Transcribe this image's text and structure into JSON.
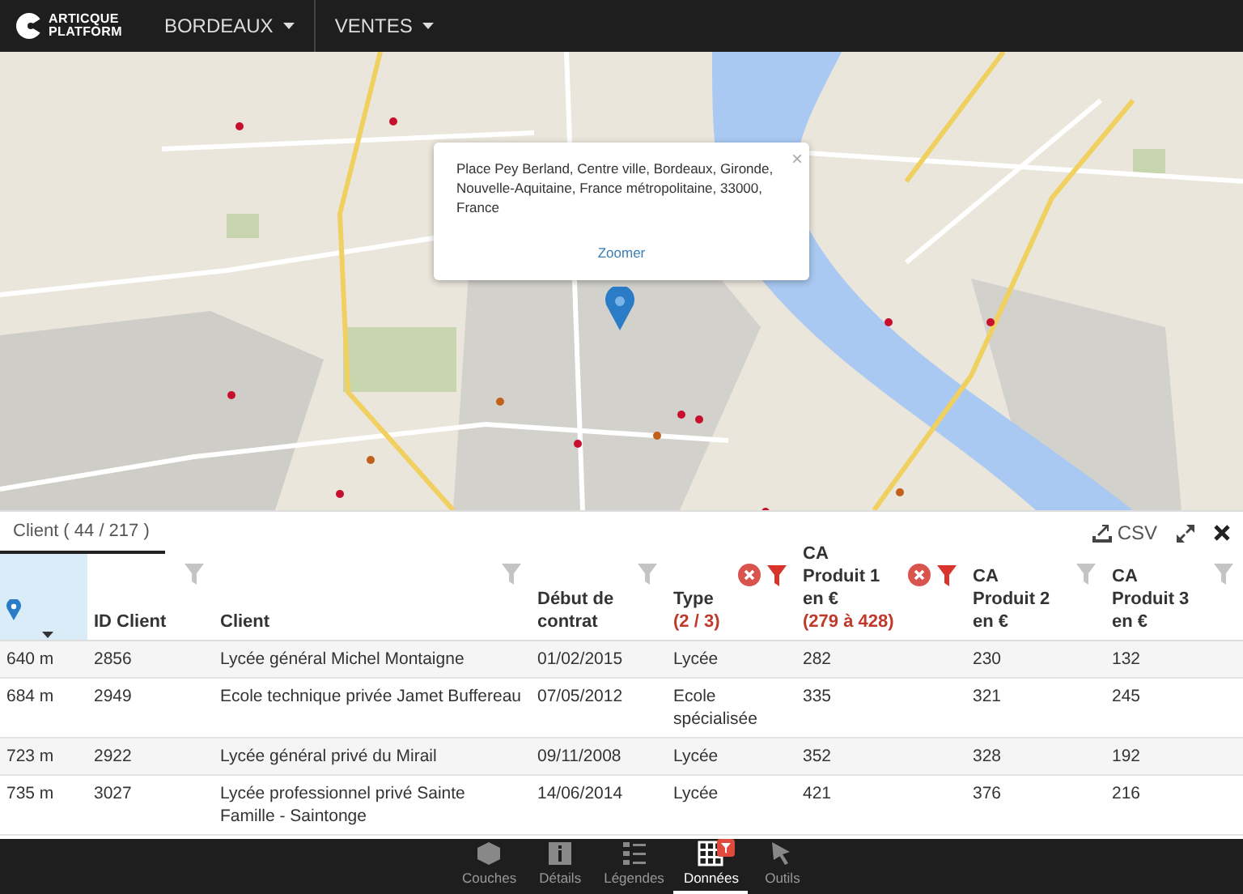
{
  "top_bar": {
    "logo": {
      "line_1": "ARTICQUE",
      "line_2": "PLATFORM"
    },
    "menus": [
      {
        "label": "BORDEAUX"
      },
      {
        "label": "VENTES"
      }
    ]
  },
  "map": {
    "popup": {
      "address": "Place Pey Berland, Centre ville, Bordeaux, Gironde, Nouvelle-Aquitaine, France métropolitaine, 33000, France",
      "close": "×",
      "link": "Zoomer"
    }
  },
  "table_panel": {
    "tab": {
      "label": "Client ( 44 / 217 )",
      "selected": true
    },
    "export_label": "CSV",
    "columns": [
      {
        "kind": "icon",
        "sorted": true
      },
      {
        "kind": "text",
        "label": "ID Client",
        "filter_active": false
      },
      {
        "kind": "text",
        "label": "Client",
        "filter_active": false
      },
      {
        "kind": "text",
        "label": "Début de contrat",
        "filter_active": false
      },
      {
        "kind": "text",
        "label": "Type",
        "filter_active": true,
        "filter_summary": "(2 / 3)"
      },
      {
        "kind": "text",
        "label": "CA Produit 1 en €",
        "filter_active": true,
        "filter_summary": "(279 à 428)"
      },
      {
        "kind": "text",
        "label": "CA Produit 2 en €",
        "filter_active": false
      },
      {
        "kind": "text",
        "label": "CA Produit 3 en €",
        "filter_active": false
      }
    ],
    "rows": [
      [
        "640 m",
        "2856",
        "Lycée général Michel Montaigne",
        "01/02/2015",
        "Lycée",
        "282",
        "230",
        "132"
      ],
      [
        "684 m",
        "2949",
        "Ecole technique privée Jamet Buffereau",
        "07/05/2012",
        "Ecole spécialisée",
        "335",
        "321",
        "245"
      ],
      [
        "723 m",
        "2922",
        "Lycée général privé du Mirail",
        "09/11/2008",
        "Lycée",
        "352",
        "328",
        "192"
      ],
      [
        "735 m",
        "3027",
        "Lycée professionnel privé Sainte Famille - Saintonge",
        "14/06/2014",
        "Lycée",
        "421",
        "376",
        "216"
      ]
    ]
  },
  "bottom_nav": [
    {
      "kind": "layers",
      "label": "Couches",
      "selected": false,
      "filtered": false
    },
    {
      "kind": "info",
      "label": "Détails",
      "selected": false,
      "filtered": false
    },
    {
      "kind": "legend",
      "label": "Légendes",
      "selected": false,
      "filtered": false
    },
    {
      "kind": "grid",
      "label": "Données",
      "selected": true,
      "filtered": true
    },
    {
      "kind": "cursor",
      "label": "Outils",
      "selected": false,
      "filtered": false
    }
  ]
}
